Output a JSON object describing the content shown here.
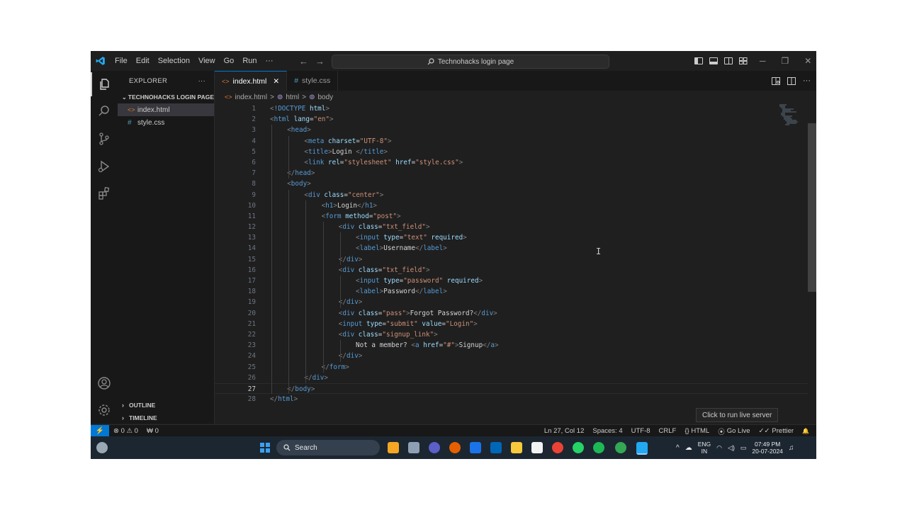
{
  "titlebar": {
    "menu": [
      "File",
      "Edit",
      "Selection",
      "View",
      "Go",
      "Run",
      "···"
    ],
    "search_text": "Technohacks login page",
    "nav_back": "←",
    "nav_forward": "→",
    "minimize": "─",
    "restore": "❐",
    "close": "✕"
  },
  "sidebar": {
    "title": "EXPLORER",
    "more": "···",
    "folder": "TECHNOHACKS LOGIN PAGE",
    "files": [
      {
        "name": "index.html",
        "icon": "html-file-icon"
      },
      {
        "name": "style.css",
        "icon": "css-file-icon"
      }
    ],
    "outline": "OUTLINE",
    "timeline": "TIMELINE"
  },
  "tabs": [
    {
      "label": "index.html",
      "active": true,
      "close": "✕",
      "icon_glyph": "<>"
    },
    {
      "label": "style.css",
      "active": false,
      "icon_glyph": "#"
    }
  ],
  "breadcrumb": {
    "file": "index.html",
    "sep": ">",
    "items": [
      "html",
      "body"
    ]
  },
  "editor": {
    "current_line": 27,
    "lines": [
      {
        "n": "1",
        "indent": 0,
        "tokens": [
          [
            "br",
            "<"
          ],
          [
            "tag",
            "!DOCTYPE "
          ],
          [
            "attr",
            "html"
          ],
          [
            "br",
            ">"
          ]
        ]
      },
      {
        "n": "2",
        "indent": 0,
        "tokens": [
          [
            "br",
            "<"
          ],
          [
            "tag",
            "html "
          ],
          [
            "attr",
            "lang"
          ],
          [
            "txt",
            "="
          ],
          [
            "str",
            "\"en\""
          ],
          [
            "br",
            ">"
          ]
        ]
      },
      {
        "n": "3",
        "indent": 1,
        "tokens": [
          [
            "br",
            "<"
          ],
          [
            "tag",
            "head"
          ],
          [
            "br",
            ">"
          ]
        ]
      },
      {
        "n": "4",
        "indent": 2,
        "tokens": [
          [
            "br",
            "<"
          ],
          [
            "tag",
            "meta "
          ],
          [
            "attr",
            "charset"
          ],
          [
            "txt",
            "="
          ],
          [
            "str",
            "\"UTF-8\""
          ],
          [
            "br",
            ">"
          ]
        ]
      },
      {
        "n": "5",
        "indent": 2,
        "tokens": [
          [
            "br",
            "<"
          ],
          [
            "tag",
            "title"
          ],
          [
            "br",
            ">"
          ],
          [
            "txt",
            "Login "
          ],
          [
            "br",
            "</"
          ],
          [
            "tag",
            "title"
          ],
          [
            "br",
            ">"
          ]
        ]
      },
      {
        "n": "6",
        "indent": 2,
        "tokens": [
          [
            "br",
            "<"
          ],
          [
            "tag",
            "link "
          ],
          [
            "attr",
            "rel"
          ],
          [
            "txt",
            "="
          ],
          [
            "str",
            "\"stylesheet\" "
          ],
          [
            "attr",
            "href"
          ],
          [
            "txt",
            "="
          ],
          [
            "str",
            "\"style.css\""
          ],
          [
            "br",
            ">"
          ]
        ]
      },
      {
        "n": "7",
        "indent": 1,
        "tokens": [
          [
            "br",
            "</"
          ],
          [
            "tag",
            "head"
          ],
          [
            "br",
            ">"
          ]
        ]
      },
      {
        "n": "8",
        "indent": 1,
        "tokens": [
          [
            "br",
            "<"
          ],
          [
            "tag",
            "body"
          ],
          [
            "br",
            ">"
          ]
        ]
      },
      {
        "n": "9",
        "indent": 2,
        "tokens": [
          [
            "br",
            "<"
          ],
          [
            "tag",
            "div "
          ],
          [
            "attr",
            "class"
          ],
          [
            "txt",
            "="
          ],
          [
            "str",
            "\"center\""
          ],
          [
            "br",
            ">"
          ]
        ]
      },
      {
        "n": "10",
        "indent": 3,
        "tokens": [
          [
            "br",
            "<"
          ],
          [
            "tag",
            "h1"
          ],
          [
            "br",
            ">"
          ],
          [
            "txt",
            "Login"
          ],
          [
            "br",
            "</"
          ],
          [
            "tag",
            "h1"
          ],
          [
            "br",
            ">"
          ]
        ]
      },
      {
        "n": "11",
        "indent": 3,
        "tokens": [
          [
            "br",
            "<"
          ],
          [
            "tag",
            "form "
          ],
          [
            "attr",
            "method"
          ],
          [
            "txt",
            "="
          ],
          [
            "str",
            "\"post\""
          ],
          [
            "br",
            ">"
          ]
        ]
      },
      {
        "n": "12",
        "indent": 4,
        "tokens": [
          [
            "br",
            "<"
          ],
          [
            "tag",
            "div "
          ],
          [
            "attr",
            "class"
          ],
          [
            "txt",
            "="
          ],
          [
            "str",
            "\"txt_field\""
          ],
          [
            "br",
            ">"
          ]
        ]
      },
      {
        "n": "13",
        "indent": 5,
        "tokens": [
          [
            "br",
            "<"
          ],
          [
            "tag",
            "input "
          ],
          [
            "attr",
            "type"
          ],
          [
            "txt",
            "="
          ],
          [
            "str",
            "\"text\" "
          ],
          [
            "attr",
            "required"
          ],
          [
            "br",
            ">"
          ]
        ]
      },
      {
        "n": "14",
        "indent": 5,
        "tokens": [
          [
            "br",
            "<"
          ],
          [
            "tag",
            "label"
          ],
          [
            "br",
            ">"
          ],
          [
            "txt",
            "Username"
          ],
          [
            "br",
            "</"
          ],
          [
            "tag",
            "label"
          ],
          [
            "br",
            ">"
          ]
        ]
      },
      {
        "n": "15",
        "indent": 4,
        "tokens": [
          [
            "br",
            "</"
          ],
          [
            "tag",
            "div"
          ],
          [
            "br",
            ">"
          ]
        ]
      },
      {
        "n": "16",
        "indent": 4,
        "tokens": [
          [
            "br",
            "<"
          ],
          [
            "tag",
            "div "
          ],
          [
            "attr",
            "class"
          ],
          [
            "txt",
            "="
          ],
          [
            "str",
            "\"txt_field\""
          ],
          [
            "br",
            ">"
          ]
        ]
      },
      {
        "n": "17",
        "indent": 5,
        "tokens": [
          [
            "br",
            "<"
          ],
          [
            "tag",
            "input "
          ],
          [
            "attr",
            "type"
          ],
          [
            "txt",
            "="
          ],
          [
            "str",
            "\"password\" "
          ],
          [
            "attr",
            "required"
          ],
          [
            "br",
            ">"
          ]
        ]
      },
      {
        "n": "18",
        "indent": 5,
        "tokens": [
          [
            "br",
            "<"
          ],
          [
            "tag",
            "label"
          ],
          [
            "br",
            ">"
          ],
          [
            "txt",
            "Password"
          ],
          [
            "br",
            "</"
          ],
          [
            "tag",
            "label"
          ],
          [
            "br",
            ">"
          ]
        ]
      },
      {
        "n": "19",
        "indent": 4,
        "tokens": [
          [
            "br",
            "</"
          ],
          [
            "tag",
            "div"
          ],
          [
            "br",
            ">"
          ]
        ]
      },
      {
        "n": "20",
        "indent": 4,
        "tokens": [
          [
            "br",
            "<"
          ],
          [
            "tag",
            "div "
          ],
          [
            "attr",
            "class"
          ],
          [
            "txt",
            "="
          ],
          [
            "str",
            "\"pass\""
          ],
          [
            "br",
            ">"
          ],
          [
            "txt",
            "Forgot Password?"
          ],
          [
            "br",
            "</"
          ],
          [
            "tag",
            "div"
          ],
          [
            "br",
            ">"
          ]
        ]
      },
      {
        "n": "21",
        "indent": 4,
        "tokens": [
          [
            "br",
            "<"
          ],
          [
            "tag",
            "input "
          ],
          [
            "attr",
            "type"
          ],
          [
            "txt",
            "="
          ],
          [
            "str",
            "\"submit\" "
          ],
          [
            "attr",
            "value"
          ],
          [
            "txt",
            "="
          ],
          [
            "str",
            "\"Login\""
          ],
          [
            "br",
            ">"
          ]
        ]
      },
      {
        "n": "22",
        "indent": 4,
        "tokens": [
          [
            "br",
            "<"
          ],
          [
            "tag",
            "div "
          ],
          [
            "attr",
            "class"
          ],
          [
            "txt",
            "="
          ],
          [
            "str",
            "\"signup_link\""
          ],
          [
            "br",
            ">"
          ]
        ]
      },
      {
        "n": "23",
        "indent": 5,
        "tokens": [
          [
            "txt",
            "Not a member? "
          ],
          [
            "br",
            "<"
          ],
          [
            "tag",
            "a "
          ],
          [
            "attr",
            "href"
          ],
          [
            "txt",
            "="
          ],
          [
            "str",
            "\"#\""
          ],
          [
            "br",
            ">"
          ],
          [
            "txt",
            "Signup"
          ],
          [
            "br",
            "</"
          ],
          [
            "tag",
            "a"
          ],
          [
            "br",
            ">"
          ]
        ]
      },
      {
        "n": "24",
        "indent": 4,
        "tokens": [
          [
            "br",
            "</"
          ],
          [
            "tag",
            "div"
          ],
          [
            "br",
            ">"
          ]
        ]
      },
      {
        "n": "25",
        "indent": 3,
        "tokens": [
          [
            "br",
            "</"
          ],
          [
            "tag",
            "form"
          ],
          [
            "br",
            ">"
          ]
        ]
      },
      {
        "n": "26",
        "indent": 2,
        "tokens": [
          [
            "br",
            "</"
          ],
          [
            "tag",
            "div"
          ],
          [
            "br",
            ">"
          ]
        ]
      },
      {
        "n": "27",
        "indent": 1,
        "tokens": [
          [
            "br",
            "</"
          ],
          [
            "tag",
            "body"
          ],
          [
            "br",
            ">"
          ]
        ]
      },
      {
        "n": "28",
        "indent": 0,
        "tokens": [
          [
            "br",
            "</"
          ],
          [
            "tag",
            "html"
          ],
          [
            "br",
            ">"
          ]
        ]
      }
    ]
  },
  "tooltip": "Click to run live server",
  "statusbar": {
    "remote": "⚡",
    "problems": "⊗ 0 ⚠ 0",
    "ports": "₩ 0",
    "position": "Ln 27, Col 12",
    "spaces": "Spaces: 4",
    "encoding": "UTF-8",
    "eol": "CRLF",
    "language": "{} HTML",
    "golive": "Go Live",
    "prettier": "Prettier",
    "bell": "🔔"
  },
  "taskbar": {
    "search": "Search",
    "lang_top": "ENG",
    "lang_bottom": "IN",
    "time": "07:49 PM",
    "date": "20-07-2024",
    "tray_arrow": "^"
  },
  "colors": {
    "accent": "#0078d4",
    "editor_bg": "#1f1f1f",
    "sidebar_bg": "#181818",
    "taskbar_bg": "#1c2631"
  }
}
